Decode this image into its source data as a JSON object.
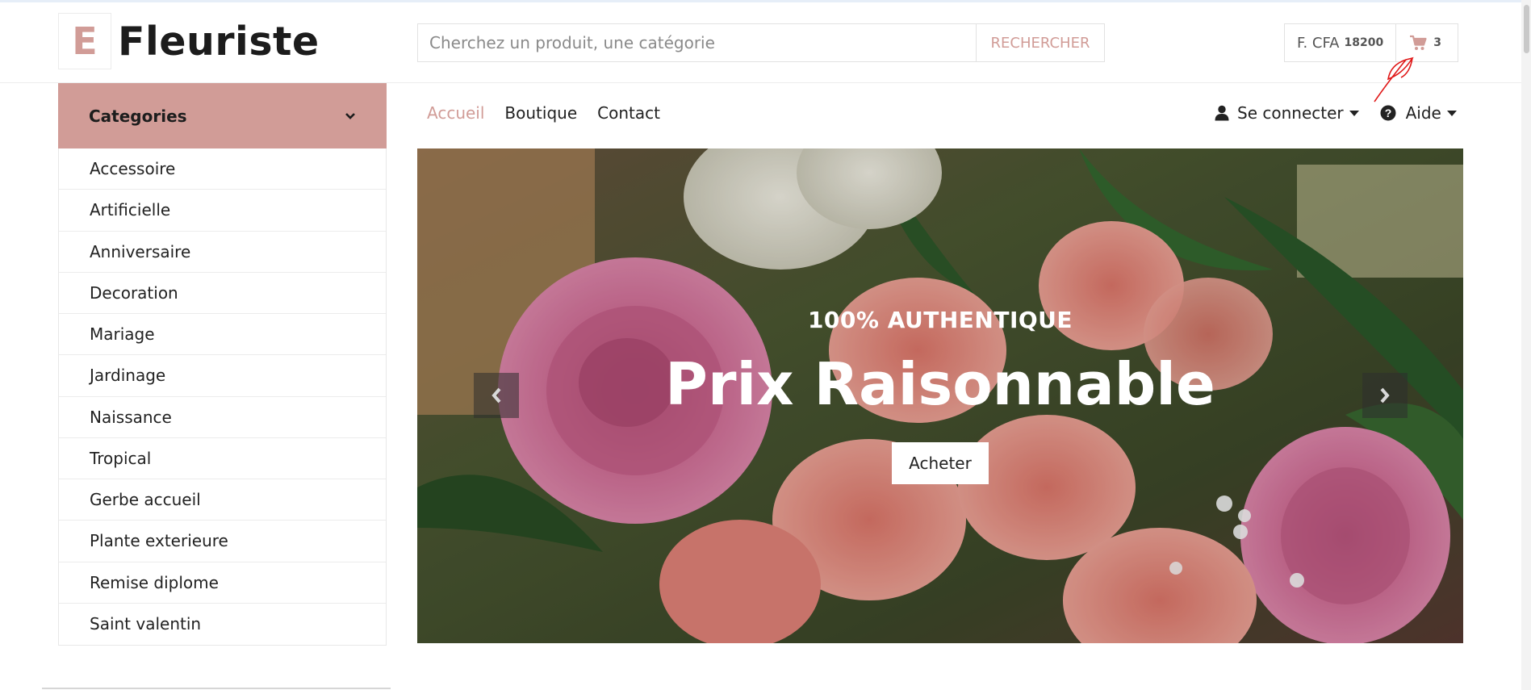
{
  "brand": {
    "logo_letter": "E",
    "name": "Fleuriste",
    "accent_color": "#d19c97"
  },
  "search": {
    "placeholder": "Cherchez un produit, une catégorie",
    "value": "",
    "button_label": "RECHERCHER",
    "icon": "none"
  },
  "wallet": {
    "currency_label": "F. CFA",
    "amount": "18200"
  },
  "cart": {
    "icon": "cart-icon",
    "count": "3"
  },
  "sidebar": {
    "title": "Categories",
    "toggle_icon": "chevron-down-icon",
    "items": [
      {
        "label": "Accessoire"
      },
      {
        "label": "Artificielle"
      },
      {
        "label": "Anniversaire"
      },
      {
        "label": "Decoration"
      },
      {
        "label": "Mariage"
      },
      {
        "label": "Jardinage"
      },
      {
        "label": "Naissance"
      },
      {
        "label": "Tropical"
      },
      {
        "label": "Gerbe accueil"
      },
      {
        "label": "Plante exterieure"
      },
      {
        "label": "Remise diplome"
      },
      {
        "label": "Saint valentin"
      }
    ]
  },
  "nav": {
    "links": [
      {
        "label": "Accueil",
        "active": true
      },
      {
        "label": "Boutique",
        "active": false
      },
      {
        "label": "Contact",
        "active": false
      }
    ],
    "login_label": "Se connecter",
    "help_label": "Aide"
  },
  "hero": {
    "kicker": "100% AUTHENTIQUE",
    "title": "Prix Raisonnable",
    "button_label": "Acheter",
    "prev_icon": "chevron-left-icon",
    "next_icon": "chevron-right-icon"
  }
}
